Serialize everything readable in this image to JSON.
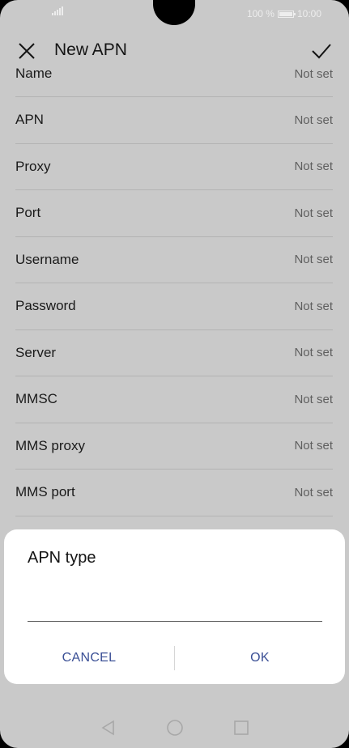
{
  "status_bar": {
    "battery_percent": "100 %",
    "time": "10:00"
  },
  "header": {
    "title": "New APN",
    "close_icon": "close-icon",
    "confirm_icon": "check-icon"
  },
  "fields": [
    {
      "label": "Name",
      "value": "Not set"
    },
    {
      "label": "APN",
      "value": "Not set"
    },
    {
      "label": "Proxy",
      "value": "Not set"
    },
    {
      "label": "Port",
      "value": "Not set"
    },
    {
      "label": "Username",
      "value": "Not set"
    },
    {
      "label": "Password",
      "value": "Not set"
    },
    {
      "label": "Server",
      "value": "Not set"
    },
    {
      "label": "MMSC",
      "value": "Not set"
    },
    {
      "label": "MMS proxy",
      "value": "Not set"
    },
    {
      "label": "MMS port",
      "value": "Not set"
    }
  ],
  "dialog": {
    "title": "APN type",
    "input_value": "",
    "cancel_label": "CANCEL",
    "ok_label": "OK"
  },
  "colors": {
    "dim_background": "#c9c9c9",
    "dialog_button": "#3a4f95"
  }
}
